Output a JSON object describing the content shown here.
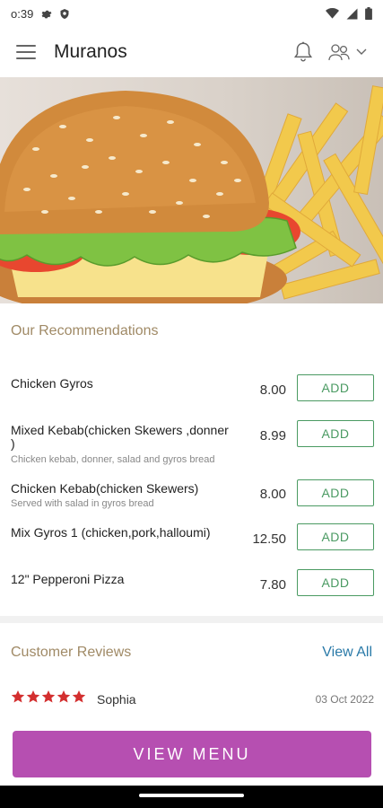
{
  "status_bar": {
    "time": "o:39"
  },
  "app_bar": {
    "title": "Muranos"
  },
  "recommendations": {
    "title": "Our Recommendations",
    "add_label": "ADD",
    "items": [
      {
        "name": "Chicken Gyros",
        "description": "",
        "price": "8.00"
      },
      {
        "name": "Mixed Kebab(chicken Skewers ,donner )",
        "description": "Chicken kebab, donner, salad and gyros bread",
        "price": "8.99"
      },
      {
        "name": "Chicken Kebab(chicken Skewers)",
        "description": "Served with salad in gyros bread",
        "price": "8.00"
      },
      {
        "name": "Mix Gyros 1 (chicken,pork,halloumi)",
        "description": "",
        "price": "12.50"
      },
      {
        "name": "12\" Pepperoni Pizza",
        "description": "",
        "price": "7.80"
      }
    ]
  },
  "reviews": {
    "title": "Customer Reviews",
    "view_all_label": "View All",
    "latest": {
      "reviewer": "Sophia",
      "date": "03 Oct 2022",
      "rating": 5
    }
  },
  "view_menu_label": "VIEW MENU",
  "colors": {
    "accent": "#b64fb1",
    "add_green": "#4a9a62",
    "section_gold": "#a08a66",
    "link_blue": "#2a7aa8",
    "star_red": "#d32f2f"
  }
}
